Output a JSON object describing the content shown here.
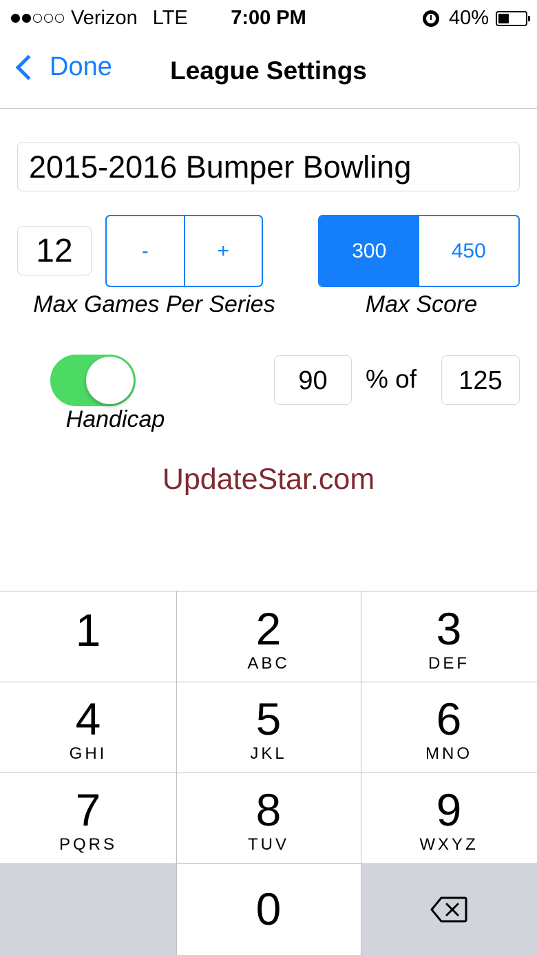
{
  "status_bar": {
    "carrier": "Verizon",
    "network": "LTE",
    "time": "7:00 PM",
    "battery_pct": "40%",
    "battery_level": 0.4,
    "signal_bars_filled": 2,
    "signal_bars_total": 5
  },
  "nav": {
    "back_label": "Done",
    "title": "League Settings"
  },
  "league_name": "2015-2016 Bumper Bowling",
  "max_games": {
    "value": "12",
    "minus_label": "-",
    "plus_label": "+",
    "caption": "Max Games Per Series"
  },
  "max_score": {
    "options": [
      "300",
      "450"
    ],
    "selected": "300",
    "caption": "Max Score"
  },
  "handicap": {
    "enabled": true,
    "caption": "Handicap",
    "percent": "90",
    "percent_of_label": "% of",
    "base": "125"
  },
  "watermark": "UpdateStar.com",
  "keypad": {
    "keys": [
      {
        "digit": "1",
        "letters": ""
      },
      {
        "digit": "2",
        "letters": "ABC"
      },
      {
        "digit": "3",
        "letters": "DEF"
      },
      {
        "digit": "4",
        "letters": "GHI"
      },
      {
        "digit": "5",
        "letters": "JKL"
      },
      {
        "digit": "6",
        "letters": "MNO"
      },
      {
        "digit": "7",
        "letters": "PQRS"
      },
      {
        "digit": "8",
        "letters": "TUV"
      },
      {
        "digit": "9",
        "letters": "WXYZ"
      },
      {
        "digit": "0",
        "letters": ""
      }
    ],
    "backspace_icon": "backspace-icon"
  },
  "colors": {
    "accent": "#147efb",
    "toggle_on": "#4cd964",
    "watermark": "#7f2a30"
  }
}
